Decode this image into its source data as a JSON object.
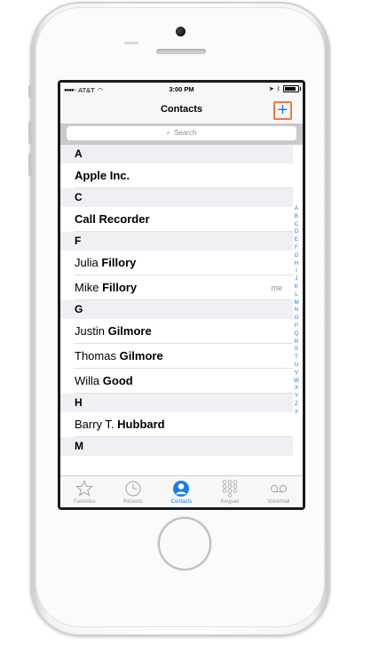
{
  "status_bar": {
    "carrier": "AT&T",
    "time": "3:00 PM"
  },
  "nav": {
    "title": "Contacts",
    "add_label": "+"
  },
  "search": {
    "placeholder": "Search"
  },
  "list": [
    {
      "type": "section",
      "letter": "A"
    },
    {
      "type": "contact",
      "first": "",
      "last": "Apple Inc."
    },
    {
      "type": "section",
      "letter": "C"
    },
    {
      "type": "contact",
      "first": "",
      "last": "Call Recorder"
    },
    {
      "type": "section",
      "letter": "F"
    },
    {
      "type": "contact",
      "first": "Julia",
      "last": "Fillory"
    },
    {
      "type": "contact",
      "first": "Mike",
      "last": "Fillory",
      "badge": "me"
    },
    {
      "type": "section",
      "letter": "G"
    },
    {
      "type": "contact",
      "first": "Justin",
      "last": "Gilmore"
    },
    {
      "type": "contact",
      "first": "Thomas",
      "last": "Gilmore"
    },
    {
      "type": "contact",
      "first": "Willa",
      "last": "Good"
    },
    {
      "type": "section",
      "letter": "H"
    },
    {
      "type": "contact",
      "first": "Barry T.",
      "last": "Hubbard"
    },
    {
      "type": "section",
      "letter": "M"
    }
  ],
  "index_letters": [
    "A",
    "B",
    "C",
    "D",
    "E",
    "F",
    "G",
    "H",
    "I",
    "J",
    "K",
    "L",
    "M",
    "N",
    "O",
    "P",
    "Q",
    "R",
    "S",
    "T",
    "U",
    "V",
    "W",
    "X",
    "Y",
    "Z",
    "#"
  ],
  "tabs": [
    {
      "label": "Favorites",
      "icon": "star-icon",
      "active": false
    },
    {
      "label": "Recents",
      "icon": "clock-icon",
      "active": false
    },
    {
      "label": "Contacts",
      "icon": "person-icon",
      "active": true
    },
    {
      "label": "Keypad",
      "icon": "keypad-icon",
      "active": false
    },
    {
      "label": "Voicemail",
      "icon": "voicemail-icon",
      "active": false
    }
  ],
  "colors": {
    "accent": "#1a7cf0",
    "highlight": "#f07a3c",
    "section_bg": "#efeff4"
  }
}
